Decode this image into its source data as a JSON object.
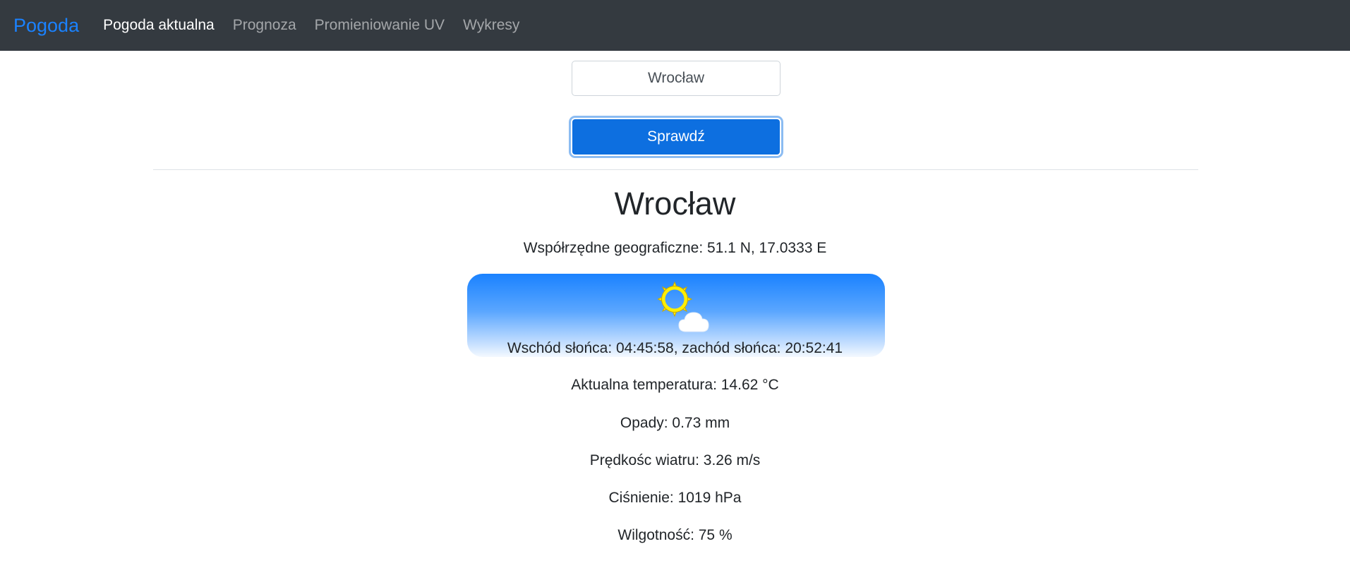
{
  "navbar": {
    "brand": "Pogoda",
    "items": [
      {
        "label": "Pogoda aktualna",
        "active": true
      },
      {
        "label": "Prognoza",
        "active": false
      },
      {
        "label": "Promieniowanie UV",
        "active": false
      },
      {
        "label": "Wykresy",
        "active": false
      }
    ]
  },
  "search": {
    "value": "Wrocław",
    "button_label": "Sprawdź"
  },
  "result": {
    "city": "Wrocław",
    "coordinates": "Współrzędne geograficzne: 51.1 N, 17.0333 E",
    "weather_icon": "sun-behind-cloud-icon",
    "sun_times": "Wschód słońca: 04:45:58, zachód słońca: 20:52:41",
    "temperature": "Aktualna temperatura: 14.62 °C",
    "precipitation": "Opady: 0.73 mm",
    "wind": "Prędkośc wiatru: 3.26 m/s",
    "pressure": "Ciśnienie: 1019 hPa",
    "humidity": "Wilgotność: 75 %"
  },
  "colors": {
    "navbar_bg": "#343a40",
    "brand": "#1a82ff",
    "button_bg": "#0d6fe0",
    "sky_top": "#1a82ff",
    "sun": "#ffee00"
  }
}
